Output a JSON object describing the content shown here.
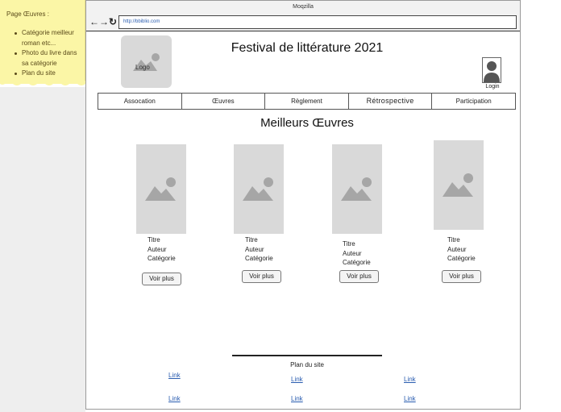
{
  "sticky": {
    "title": "Page Œuvres :",
    "items": [
      "Catégorie meilleur roman etc...",
      "Photo du livre dans sa catégorie",
      "Plan du site"
    ]
  },
  "browser": {
    "title": "Moqzilla",
    "url": "http://bbiblio.com",
    "back_icon": "←",
    "forward_icon": "→",
    "reload_icon": "↻"
  },
  "header": {
    "logo_label": "Logo",
    "title": "Festival de littérature 2021",
    "login_label": "Login"
  },
  "nav": {
    "items": [
      "Assocation",
      "Œuvres",
      "Règlement",
      "Rétrospective",
      "Participation"
    ]
  },
  "main": {
    "section_title": "Meilleurs Œuvres",
    "cards": [
      {
        "titre": "Titre",
        "auteur": "Auteur",
        "categorie": "Catégorie",
        "button": "Voir plus"
      },
      {
        "titre": "Titre",
        "auteur": "Auteur",
        "categorie": "Catégorie",
        "button": "Voir plus"
      },
      {
        "titre": "Titre",
        "auteur": "Auteur",
        "categorie": "Catégorie",
        "button": "Voir plus"
      },
      {
        "titre": "Titre",
        "auteur": "Auteur",
        "categorie": "Catégorie",
        "button": "Voir plus"
      }
    ]
  },
  "footer": {
    "title": "Plan du site",
    "links": [
      "Link",
      "Link",
      "Link",
      "Link",
      "Link",
      "Link"
    ]
  },
  "colors": {
    "sticky": "#fbf6a6",
    "placeholder": "#d9d9d9",
    "link": "#2a5db0"
  }
}
